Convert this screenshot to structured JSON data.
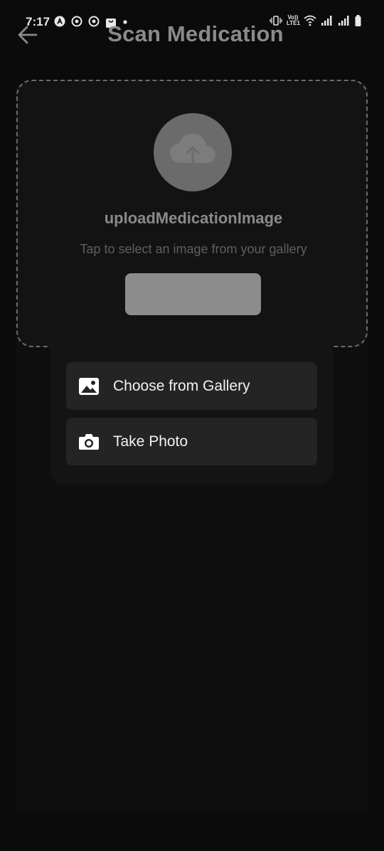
{
  "status_bar": {
    "time": "7:17",
    "left_icons": [
      "a-icon",
      "chrome-icon",
      "chrome-icon",
      "shopping-bag-icon",
      "dot-icon"
    ],
    "lte_label": "Vo)) LTE1",
    "right_icons": [
      "vibrate-icon",
      "wifi-icon",
      "signal-icon",
      "signal-icon",
      "battery-icon"
    ]
  },
  "header": {
    "title": "Scan Medication",
    "back_icon": "arrow-left-icon"
  },
  "upload": {
    "icon": "cloud-upload-icon",
    "title": "uploadMedicationImage",
    "subtitle": "Tap to select an image from your gallery",
    "button_label": ""
  },
  "menu": {
    "items": [
      {
        "label": "Choose from Gallery",
        "icon": "image-icon"
      },
      {
        "label": "Take Photo",
        "icon": "camera-icon"
      }
    ]
  },
  "colors": {
    "background": "#0b0b0b",
    "title": "#8a8a8a",
    "upload_circle": "#6b6b6b",
    "upload_button": "#8c8c8c",
    "menu_item_bg": "#242424",
    "menu_bg": "#141414"
  }
}
